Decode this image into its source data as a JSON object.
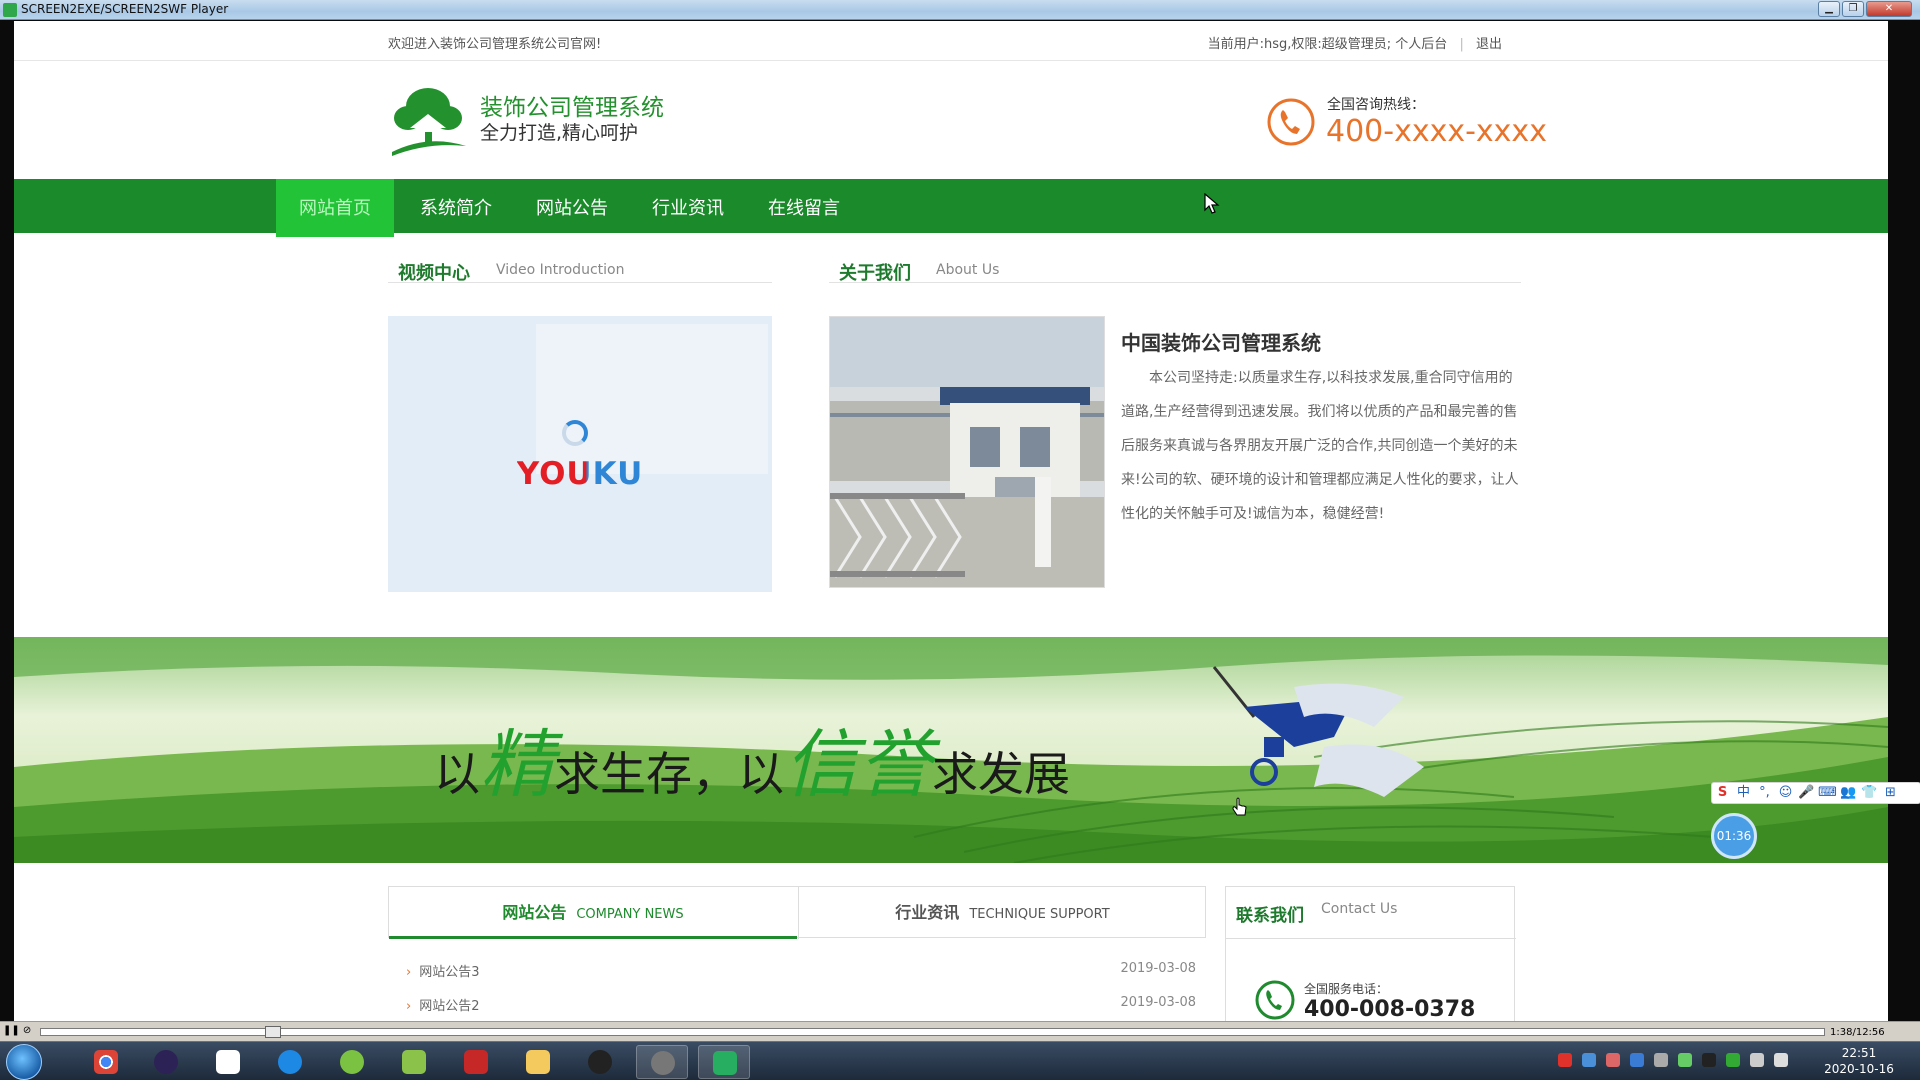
{
  "window": {
    "title": "SCREEN2EXE/SCREEN2SWF Player"
  },
  "topbar": {
    "welcome": "欢迎进入装饰公司管理系统公司官网!",
    "user_info": "当前用户:hsg,权限:超级管理员;",
    "personal_link": "个人后台",
    "sep": "|",
    "logout_link": "退出"
  },
  "header": {
    "site_name": "装饰公司管理系统",
    "slogan": "全力打造,精心呵护",
    "hotline_label": "全国咨询热线：",
    "hotline_number": "400-xxxx-xxxx"
  },
  "nav": {
    "items": [
      {
        "label": "网站首页"
      },
      {
        "label": "系统简介"
      },
      {
        "label": "网站公告"
      },
      {
        "label": "行业资讯"
      },
      {
        "label": "在线留言"
      }
    ],
    "active": "网站首页"
  },
  "video_section": {
    "title_cn": "视频中心",
    "title_en": "Video Introduction",
    "player_brand": "YOUKU"
  },
  "about_section": {
    "title_cn": "关于我们",
    "title_en": "About Us",
    "heading": "中国装饰公司管理系统",
    "paragraph": "本公司坚持走:以质量求生存,以科技求发展,重合同守信用的道路,生产经营得到迅速发展。我们将以优质的产品和最完善的售后服务来真诚与各界朋友开展广泛的合作,共同创造一个美好的未来!公司的软、硬环境的设计和管理都应满足人性化的要求，让人性化的关怀触手可及!诚信为本，稳健经营!"
  },
  "banner": {
    "part1": "以",
    "big1": "精",
    "part2": "求生存，以",
    "big2": "信誉",
    "part3": "求发展"
  },
  "news_tabs": {
    "tabs": [
      {
        "cn": "网站公告",
        "en": "COMPANY NEWS"
      },
      {
        "cn": "行业资讯",
        "en": "TECHNIQUE SUPPORT"
      }
    ],
    "items": [
      {
        "title": "网站公告3",
        "date": "2019-03-08"
      },
      {
        "title": "网站公告2",
        "date": "2019-03-08"
      }
    ]
  },
  "contact": {
    "title_cn": "联系我们",
    "title_en": "Contact Us",
    "label": "全国服务电话：",
    "number": "400-008-0378"
  },
  "ime_toolbar": {
    "items": [
      "S",
      "中",
      "°,",
      "☺",
      "🎤",
      "⌨",
      "👥",
      "👕",
      "⊞"
    ]
  },
  "timer": "01:36",
  "player": {
    "time": "1:38/12:56"
  },
  "taskbar": {
    "clock_time": "22:51",
    "clock_date": "2020-10-16"
  },
  "colors": {
    "brand_green": "#1a8a2b",
    "nav_active": "#22c337",
    "accent_orange": "#e8742b"
  },
  "icons": {
    "logo": "house-tree-icon",
    "phone": "phone-icon",
    "start": "windows-start-icon"
  }
}
